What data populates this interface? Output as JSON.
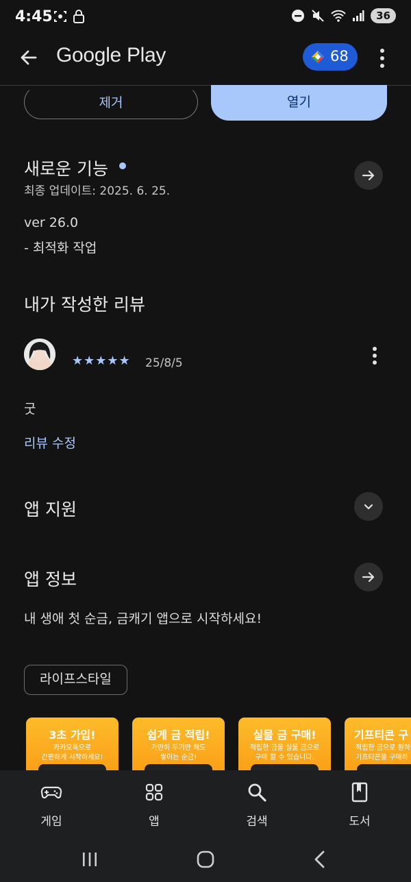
{
  "status_bar": {
    "time": "4:45",
    "battery": "36",
    "icons": [
      "screenshot-icon",
      "lock-icon",
      "dnd-icon",
      "mute-icon",
      "wifi-icon",
      "signal-icon"
    ]
  },
  "app_bar": {
    "title": "Google Play",
    "points": "68",
    "icons": [
      "back-arrow-icon",
      "play-points-icon",
      "more-vert-icon"
    ]
  },
  "actions": {
    "remove_label": "제거",
    "open_label": "열기"
  },
  "whats_new": {
    "title": "새로운 기능",
    "updated": "최종 업데이트: 2025. 6. 25.",
    "version": "ver 26.0",
    "note": "- 최적화 작업"
  },
  "my_review": {
    "title": "내가 작성한 리뷰",
    "stars": "★★★★★",
    "rating": 5,
    "date": "25/8/5",
    "text": "굿",
    "edit_label": "리뷰 수정"
  },
  "app_support": {
    "title": "앱 지원"
  },
  "app_info": {
    "title": "앱 정보",
    "description": "내 생애 첫 순금, 금캐기 앱으로 시작하세요!",
    "category": "라이프스타일"
  },
  "screenshots": [
    {
      "title": "3초 가입!",
      "desc_line1": "카카오톡으로",
      "desc_line2": "간편하게 시작하세요!"
    },
    {
      "title": "쉽게 금 적립!",
      "desc_line1": "가만히 두기만 해도",
      "desc_line2": "쌓이는 순금!"
    },
    {
      "title": "실물 금 구매!",
      "desc_line1": "적립한 금을 실물 금으로",
      "desc_line2": "구매 할 수 있습니다."
    },
    {
      "title": "기프티콘 구",
      "desc_line1": "적립한 금으로 원하",
      "desc_line2": "기프티콘을 구매하"
    }
  ],
  "bottom_nav": [
    {
      "label": "게임",
      "icon": "gamepad-icon"
    },
    {
      "label": "앱",
      "icon": "apps-grid-icon"
    },
    {
      "label": "검색",
      "icon": "search-icon"
    },
    {
      "label": "도서",
      "icon": "book-icon"
    }
  ],
  "colors": {
    "background": "#131313",
    "accent": "#a8c7fa",
    "points_pill": "#1f5bd6",
    "screenshot_orange": "#fa9a14"
  }
}
